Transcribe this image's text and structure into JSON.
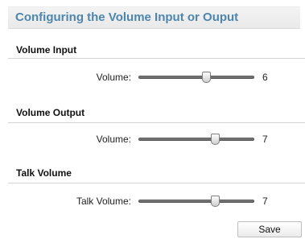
{
  "header": {
    "title": "Configuring the Volume Input or Ouput"
  },
  "sections": [
    {
      "title": "Volume Input",
      "row_label": "Volume:",
      "value": "6",
      "min": 0,
      "max": 10,
      "level": 6
    },
    {
      "title": "Volume Output",
      "row_label": "Volume:",
      "value": "7",
      "min": 0,
      "max": 10,
      "level": 7
    },
    {
      "title": "Talk Volume",
      "row_label": "Talk Volume:",
      "value": "7",
      "min": 0,
      "max": 10,
      "level": 7
    }
  ],
  "actions": {
    "save_label": "Save"
  },
  "colors": {
    "header_title": "#4f86ad",
    "header_bg": "#efefef"
  }
}
